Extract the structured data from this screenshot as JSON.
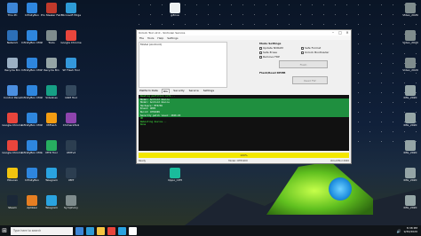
{
  "desktop_icons": [
    {
      "label": "This PC",
      "color": "#3d86d6",
      "col": 0,
      "row": 0
    },
    {
      "label": "Network",
      "color": "#2c6fb8",
      "col": 0,
      "row": 1
    },
    {
      "label": "Recycle Bin",
      "color": "#9bb0c4",
      "col": 0,
      "row": 2
    },
    {
      "label": "Control Panel",
      "color": "#4b8fe0",
      "col": 0,
      "row": 3
    },
    {
      "label": "Google Chrome",
      "color": "#e8453c",
      "col": 0,
      "row": 4
    },
    {
      "label": "Google Chrome",
      "color": "#e8453c",
      "col": 0,
      "row": 5
    },
    {
      "label": "Hiburan",
      "color": "#f1c40f",
      "col": 0,
      "row": 6
    },
    {
      "label": "Steam",
      "color": "#1b2838",
      "col": 0,
      "row": 7
    },
    {
      "label": "InfinityBox",
      "color": "#2e86de",
      "col": 1,
      "row": 0
    },
    {
      "label": "InfinityBox CM2MT2",
      "color": "#2e86de",
      "col": 1,
      "row": 1
    },
    {
      "label": "InfinityBox CM2SCR",
      "color": "#2e86de",
      "col": 1,
      "row": 2
    },
    {
      "label": "InfinityBox CM2MT2",
      "color": "#2e86de",
      "col": 1,
      "row": 3
    },
    {
      "label": "InfinityBox CM2BT",
      "color": "#2e86de",
      "col": 1,
      "row": 4
    },
    {
      "label": "InfinityBox CM2AND",
      "color": "#2e86de",
      "col": 1,
      "row": 5
    },
    {
      "label": "InfinityBox",
      "color": "#2e86de",
      "col": 1,
      "row": 6
    },
    {
      "label": "Aplikasi",
      "color": "#e67e22",
      "col": 1,
      "row": 7
    },
    {
      "label": "Pro Stealer Fail Sales",
      "color": "#c0392b",
      "col": 2,
      "row": 0
    },
    {
      "label": "Tools",
      "color": "#7f8c8d",
      "col": 2,
      "row": 1
    },
    {
      "label": "Recycle Bin",
      "color": "#95a5a6",
      "col": 2,
      "row": 2
    },
    {
      "label": "Sidelines",
      "color": "#16a085",
      "col": 2,
      "row": 3
    },
    {
      "label": "MiFlash",
      "color": "#f39c12",
      "col": 2,
      "row": 4
    },
    {
      "label": "MTK Tool",
      "color": "#27ae60",
      "col": 2,
      "row": 5
    },
    {
      "label": "Telegram",
      "color": "#2aa3e0",
      "col": 2,
      "row": 6
    },
    {
      "label": "Telegram",
      "color": "#2aa3e0",
      "col": 2,
      "row": 7
    },
    {
      "label": "Microsoft Edge",
      "color": "#2e9bd6",
      "col": 3,
      "row": 0
    },
    {
      "label": "Google Chrome",
      "color": "#e8453c",
      "col": 3,
      "row": 1
    },
    {
      "label": "SP Flash Tool",
      "color": "#3498db",
      "col": 3,
      "row": 2
    },
    {
      "label": "GSM Tool",
      "color": "#34495e",
      "col": 3,
      "row": 3
    },
    {
      "label": "ChimeraTool",
      "color": "#8e44ad",
      "col": 3,
      "row": 4
    },
    {
      "label": "UMTv2",
      "color": "#2c3e50",
      "col": 3,
      "row": 5
    },
    {
      "label": "UMT",
      "color": "#2c3e50",
      "col": 3,
      "row": 6
    },
    {
      "label": "Symphony",
      "color": "#7f8c8d",
      "col": 3,
      "row": 7
    },
    {
      "label": "gdrive",
      "color": "#ecf0f1",
      "col": 4,
      "row": 0
    },
    {
      "label": "Tools",
      "color": "#bdc3c7",
      "col": 4,
      "row": 1
    },
    {
      "label": "Hydra",
      "color": "#e74c3c",
      "col": 4,
      "row": 2
    },
    {
      "label": "Pandora",
      "color": "#9b59b6",
      "col": 4,
      "row": 3
    },
    {
      "label": "xiaomi",
      "color": "#ff6900",
      "col": 4,
      "row": 4
    },
    {
      "label": "MTK Client",
      "color": "#16a085",
      "col": 4,
      "row": 5
    },
    {
      "label": "Oppo_CPH",
      "color": "#1abc9c",
      "col": 4,
      "row": 6
    },
    {
      "label": "Video_2020",
      "color": "#7f8c8d",
      "col": 5,
      "row": 0
    },
    {
      "label": "Video_2020",
      "color": "#7f8c8d",
      "col": 5,
      "row": 1
    },
    {
      "label": "Video_2020",
      "color": "#7f8c8d",
      "col": 5,
      "row": 2
    },
    {
      "label": "IMG_2020",
      "color": "#95a5a6",
      "col": 5,
      "row": 3
    },
    {
      "label": "IMG_2020",
      "color": "#95a5a6",
      "col": 5,
      "row": 4
    },
    {
      "label": "IMG_2020",
      "color": "#95a5a6",
      "col": 5,
      "row": 5
    },
    {
      "label": "IMG_2020",
      "color": "#95a5a6",
      "col": 5,
      "row": 6
    },
    {
      "label": "IMG_2020",
      "color": "#95a5a6",
      "col": 5,
      "row": 7
    }
  ],
  "window": {
    "title": "Unlock Tool v2.0 - Sinhvien Service",
    "menu": [
      "File",
      "Tools",
      "Help",
      "Settings"
    ],
    "model_header": "Model (Android)",
    "mode_title": "Mode Settings",
    "mode_options": [
      "Update NVRAM",
      "Safe Format",
      "Safe Erase",
      "Unlock Bootloader",
      "Remove FRP"
    ],
    "flash_button": "Flash",
    "format_title": "Flash/Read RPMB",
    "read_button": "Read FW",
    "tabs": [
      "Platform Data",
      "Mtk",
      "Security",
      "Service",
      "Settings"
    ],
    "console": [
      {
        "text": "Reading partition info...",
        "hl": false
      },
      {
        "text": "Model: Android device",
        "hl": true
      },
      {
        "text": "Model: Android device",
        "hl": true
      },
      {
        "text": "Hardware: MT6765",
        "hl": true
      },
      {
        "text": "Brand: OPPO",
        "hl": true
      },
      {
        "text": "Build: CPH1909",
        "hl": true
      },
      {
        "text": "Security patch level: 2020-03",
        "hl": true
      },
      {
        "text": "OK",
        "hl": false
      },
      {
        "text": "Rebooting device...",
        "hl": false
      },
      {
        "text": "Done",
        "hl": false
      }
    ],
    "progress_label": "100%",
    "status_left": "Ready",
    "status_mid": "Model: CPH1909",
    "status_right": "UnlockTool 2020"
  },
  "taskbar": {
    "search": "Type here to search",
    "time": "8:38 PM",
    "date": "9/30/2020"
  }
}
